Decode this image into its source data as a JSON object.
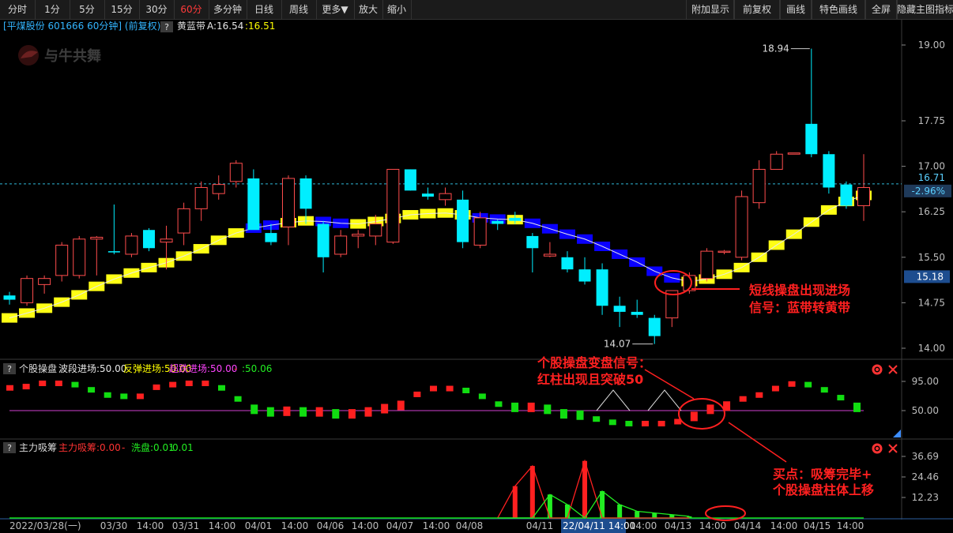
{
  "toolbar": {
    "left": [
      "分时",
      "1分",
      "5分",
      "15分",
      "30分",
      "60分",
      "多分钟",
      "日线",
      "周线",
      "更多▼",
      "放大",
      "缩小"
    ],
    "active": "60分",
    "right": [
      "附加显示",
      "前复权",
      "画线",
      "特色画线",
      "全屏",
      "隐藏主图指标"
    ]
  },
  "header": {
    "stock": "[平煤股份 601666 60分钟] (前复权)",
    "question": "?",
    "indicator_name": "黄蓝带",
    "a_label": "A:16.54",
    "b_label": ":16.51",
    "watermark": "与牛共舞"
  },
  "price_axis": {
    "ticks": [
      "19.00",
      "17.75",
      "17.00",
      "16.25",
      "15.50",
      "14.75",
      "14.00"
    ],
    "current_price": "16.71",
    "change_pct": "-2.96%",
    "crosshair_price": "15.18"
  },
  "annotations": {
    "high_label": "18.94",
    "low_label": "14.07",
    "main_note_1": "短线操盘出现进场",
    "main_note_2": "信号：蓝带转黄带",
    "osc_note_1": "个股操盘变盘信号：",
    "osc_note_2": "红柱出现且突破50",
    "vol_note_1": "买点：吸筹完毕+",
    "vol_note_2": "个股操盘柱体上移"
  },
  "osc_panel": {
    "question": "?",
    "title": "个股操盘",
    "params": [
      {
        "text": "波段进场:50.00",
        "color": "#e8e8e8"
      },
      {
        "text": "反弹进场:50.00",
        "color": "#ffff00"
      },
      {
        "text": "超跌进场:50.00",
        "color": "#ff44ff"
      },
      {
        "text": "-",
        "color": "#ff3333"
      },
      {
        "text": ":50.06",
        "color": "#22ee22"
      }
    ],
    "axis": [
      "95.00",
      "50.00"
    ],
    "gear_icon": "gear-icon",
    "close_icon": "close-icon"
  },
  "vol_panel": {
    "question": "?",
    "title": "主力吸筹",
    "params": [
      {
        "text": "主力吸筹:0.00",
        "color": "#ff3333"
      },
      {
        "text": "-",
        "color": "#ff3333"
      },
      {
        "text": "洗盘:0.01",
        "color": "#22ee22"
      },
      {
        "text": ":0.01",
        "color": "#22ee22"
      }
    ],
    "axis": [
      "36.69",
      "24.46",
      "12.23"
    ],
    "gear_icon": "gear-icon",
    "close_icon": "close-icon"
  },
  "time_axis": [
    "2022/03/28(一)",
    "03/30",
    "14:00",
    "03/31",
    "14:00",
    "04/01",
    "14:00",
    "04/06",
    "14:00",
    "04/07",
    "14:00",
    "04/08",
    "04/11",
    "22/04/11 14:00",
    "14:00",
    "04/13",
    "14:00",
    "04/14",
    "14:00",
    "04/15",
    "14:00"
  ],
  "chart_data": {
    "type": "candlestick",
    "y_range": [
      14.0,
      19.2
    ],
    "candles": [
      {
        "o": 14.87,
        "h": 14.93,
        "l": 14.72,
        "c": 14.8
      },
      {
        "o": 14.75,
        "h": 15.2,
        "l": 14.7,
        "c": 15.15
      },
      {
        "o": 15.05,
        "h": 15.2,
        "l": 14.9,
        "c": 15.15
      },
      {
        "o": 15.2,
        "h": 15.75,
        "l": 15.1,
        "c": 15.7
      },
      {
        "o": 15.2,
        "h": 15.85,
        "l": 15.15,
        "c": 15.8
      },
      {
        "o": 15.8,
        "h": 15.85,
        "l": 15.2,
        "c": 15.83
      },
      {
        "o": 15.6,
        "h": 16.37,
        "l": 15.55,
        "c": 15.58
      },
      {
        "o": 15.55,
        "h": 15.9,
        "l": 15.5,
        "c": 15.85
      },
      {
        "o": 15.95,
        "h": 15.98,
        "l": 15.6,
        "c": 15.65
      },
      {
        "o": 15.75,
        "h": 16.02,
        "l": 15.3,
        "c": 15.8
      },
      {
        "o": 15.9,
        "h": 16.4,
        "l": 15.7,
        "c": 16.3
      },
      {
        "o": 16.3,
        "h": 16.75,
        "l": 16.1,
        "c": 16.65
      },
      {
        "o": 16.55,
        "h": 16.85,
        "l": 16.45,
        "c": 16.7
      },
      {
        "o": 16.75,
        "h": 17.1,
        "l": 16.65,
        "c": 17.05
      },
      {
        "o": 16.8,
        "h": 16.95,
        "l": 16.15,
        "c": 15.95
      },
      {
        "o": 15.9,
        "h": 16.05,
        "l": 15.7,
        "c": 15.75
      },
      {
        "o": 16.0,
        "h": 16.85,
        "l": 15.7,
        "c": 16.8
      },
      {
        "o": 16.8,
        "h": 16.85,
        "l": 16.05,
        "c": 16.3
      },
      {
        "o": 16.05,
        "h": 16.1,
        "l": 15.25,
        "c": 15.5
      },
      {
        "o": 15.55,
        "h": 15.95,
        "l": 15.5,
        "c": 15.85
      },
      {
        "o": 15.85,
        "h": 15.95,
        "l": 15.65,
        "c": 15.88
      },
      {
        "o": 15.85,
        "h": 16.2,
        "l": 15.7,
        "c": 16.05
      },
      {
        "o": 15.75,
        "h": 16.95,
        "l": 15.72,
        "c": 16.95
      },
      {
        "o": 16.95,
        "h": 16.95,
        "l": 16.6,
        "c": 16.6
      },
      {
        "o": 16.55,
        "h": 16.65,
        "l": 16.45,
        "c": 16.5
      },
      {
        "o": 16.45,
        "h": 16.65,
        "l": 16.35,
        "c": 16.55
      },
      {
        "o": 16.45,
        "h": 16.6,
        "l": 15.65,
        "c": 15.75
      },
      {
        "o": 15.7,
        "h": 16.25,
        "l": 15.65,
        "c": 16.15
      },
      {
        "o": 16.1,
        "h": 16.12,
        "l": 15.95,
        "c": 16.05
      },
      {
        "o": 16.15,
        "h": 16.25,
        "l": 16.05,
        "c": 16.1
      },
      {
        "o": 15.85,
        "h": 15.9,
        "l": 15.25,
        "c": 15.65
      },
      {
        "o": 15.52,
        "h": 15.75,
        "l": 15.5,
        "c": 15.55
      },
      {
        "o": 15.5,
        "h": 15.6,
        "l": 15.25,
        "c": 15.3
      },
      {
        "o": 15.3,
        "h": 15.5,
        "l": 15.05,
        "c": 15.1
      },
      {
        "o": 15.3,
        "h": 15.4,
        "l": 14.55,
        "c": 14.7
      },
      {
        "o": 14.7,
        "h": 14.85,
        "l": 14.35,
        "c": 14.6
      },
      {
        "o": 14.6,
        "h": 14.8,
        "l": 14.5,
        "c": 14.55
      },
      {
        "o": 14.5,
        "h": 14.55,
        "l": 14.07,
        "c": 14.2
      },
      {
        "o": 14.5,
        "h": 14.85,
        "l": 14.35,
        "c": 14.95
      },
      {
        "o": 14.95,
        "h": 15.25,
        "l": 14.9,
        "c": 15.2
      },
      {
        "o": 15.15,
        "h": 15.65,
        "l": 15.1,
        "c": 15.6
      },
      {
        "o": 15.6,
        "h": 15.62,
        "l": 15.55,
        "c": 15.6
      },
      {
        "o": 15.5,
        "h": 16.6,
        "l": 15.45,
        "c": 16.5
      },
      {
        "o": 16.4,
        "h": 17.1,
        "l": 16.3,
        "c": 16.95
      },
      {
        "o": 16.95,
        "h": 17.25,
        "l": 16.95,
        "c": 17.2
      },
      {
        "o": 17.2,
        "h": 17.22,
        "l": 17.2,
        "c": 17.22
      },
      {
        "o": 17.7,
        "h": 18.94,
        "l": 17.15,
        "c": 17.2
      },
      {
        "o": 17.2,
        "h": 17.25,
        "l": 16.55,
        "c": 16.65
      },
      {
        "o": 16.7,
        "h": 16.75,
        "l": 16.3,
        "c": 16.35
      },
      {
        "o": 16.35,
        "h": 17.2,
        "l": 16.1,
        "c": 16.65
      }
    ],
    "band": [
      14.5,
      14.58,
      14.66,
      14.76,
      14.88,
      15.02,
      15.14,
      15.24,
      15.33,
      15.41,
      15.52,
      15.64,
      15.78,
      15.9,
      15.98,
      16.03,
      16.07,
      16.1,
      16.09,
      16.06,
      16.05,
      16.09,
      16.14,
      16.2,
      16.22,
      16.23,
      16.2,
      16.15,
      16.13,
      16.12,
      16.06,
      15.97,
      15.88,
      15.8,
      15.68,
      15.55,
      15.42,
      15.27,
      15.16,
      15.1,
      15.14,
      15.22,
      15.33,
      15.5,
      15.7,
      15.88,
      16.08,
      16.28,
      16.42,
      16.52
    ],
    "band_color": [
      "y",
      "y",
      "y",
      "y",
      "y",
      "y",
      "y",
      "y",
      "y",
      "y",
      "y",
      "y",
      "y",
      "y",
      "b",
      "b",
      "y",
      "y",
      "b",
      "b",
      "y",
      "y",
      "y",
      "y",
      "y",
      "y",
      "y",
      "b",
      "b",
      "y",
      "b",
      "b",
      "b",
      "b",
      "b",
      "b",
      "b",
      "b",
      "b",
      "y",
      "y",
      "y",
      "y",
      "y",
      "y",
      "y",
      "y",
      "y",
      "y",
      "y"
    ],
    "osc": [
      85,
      87,
      92,
      92,
      90,
      82,
      74,
      72,
      72,
      86,
      90,
      92,
      92,
      85,
      68,
      52,
      48,
      49,
      48,
      48,
      45,
      45,
      48,
      53,
      58,
      75,
      84,
      84,
      81,
      72,
      60,
      55,
      55,
      52,
      45,
      43,
      37,
      32,
      30,
      30,
      30,
      33,
      41,
      52,
      57,
      68,
      74,
      84,
      91,
      90,
      82,
      70,
      55
    ],
    "vol": [
      {
        "r": 0,
        "g": 0
      },
      {
        "r": 19,
        "g": 0
      },
      {
        "r": 31,
        "g": 0
      },
      {
        "r": 0,
        "g": 14
      },
      {
        "r": 0,
        "g": 8
      },
      {
        "r": 34,
        "g": 0
      },
      {
        "r": 0,
        "g": 16
      },
      {
        "r": 0,
        "g": 8
      },
      {
        "r": 0,
        "g": 4
      },
      {
        "r": 0,
        "g": 3
      },
      {
        "r": 0,
        "g": 2
      },
      {
        "r": 0,
        "g": 1
      }
    ]
  }
}
